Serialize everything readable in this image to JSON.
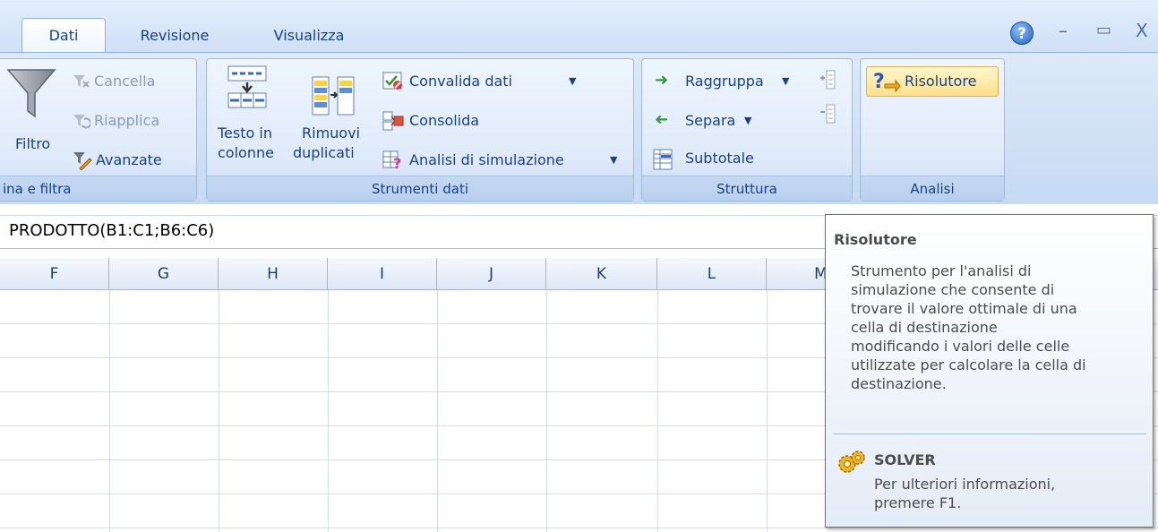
{
  "tabs": {
    "dati": "Dati",
    "revisione": "Revisione",
    "visualizza": "Visualizza"
  },
  "window": {
    "help": "?",
    "minimize": "–",
    "restore": "▭",
    "close": "X"
  },
  "ribbon": {
    "ordina": {
      "filtro": "Filtro",
      "cancella": "Cancella",
      "riapplica": "Riapplica",
      "avanzate": "Avanzate",
      "label": "ina e filtra"
    },
    "strumenti": {
      "testo_line1": "Testo in",
      "testo_line2": "colonne",
      "rimuovi_line1": "Rimuovi",
      "rimuovi_line2": "duplicati",
      "convalida": "Convalida dati",
      "consolida": "Consolida",
      "analisi": "Analisi di simulazione",
      "label": "Strumenti dati"
    },
    "struttura": {
      "raggruppa": "Raggruppa",
      "separa": "Separa",
      "subtotale": "Subtotale",
      "label": "Struttura"
    },
    "analisi": {
      "risolutore": "Risolutore",
      "label": "Analisi"
    }
  },
  "formula_bar": {
    "text": "PRODOTTO(B1:C1;B6:C6)"
  },
  "columns": [
    "F",
    "G",
    "H",
    "I",
    "J",
    "K",
    "L",
    "M"
  ],
  "tooltip": {
    "title": "Risolutore",
    "body": "Strumento per l'analisi di\nsimulazione che consente di\ntrovare il valore ottimale di una\ncella di destinazione\nmodificando i valori delle celle\nutilizzate per calcolare la cella di\ndestinazione.",
    "help_title": "SOLVER",
    "help_body": "Per ulteriori informazioni,\npremere F1."
  },
  "colors": {
    "ribbon_text": "#15428b",
    "highlight": "#ffe08a"
  }
}
